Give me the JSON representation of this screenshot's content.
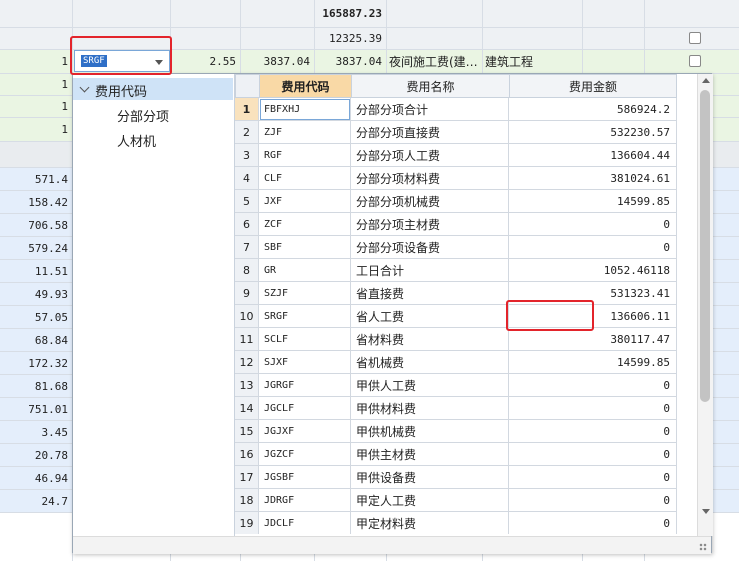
{
  "background": {
    "top_total": "165887.23",
    "subtotal": "12325.39",
    "row_a": {
      "index": "1",
      "code": "SRGF",
      "rate": "2.55",
      "amount1": "3837.04",
      "amount2": "3837.04",
      "name": "夜间施工费(建…",
      "category": "建筑工程"
    },
    "small_rows": [
      "1",
      "1",
      "1"
    ],
    "left_values": [
      "571.4",
      "158.42",
      "706.58",
      "579.24",
      "11.51",
      "49.93",
      "57.05",
      "68.84",
      "172.32",
      "81.68",
      "751.01",
      "3.45",
      "20.78",
      "46.94",
      "24.7"
    ]
  },
  "popup": {
    "tree": {
      "root": "费用代码",
      "children": [
        "分部分项",
        "人材机"
      ]
    },
    "headers": {
      "code": "费用代码",
      "name": "费用名称",
      "amount": "费用金额"
    },
    "rows": [
      {
        "num": "1",
        "code": "FBFXHJ",
        "name": "分部分项合计",
        "amount": "586924.2"
      },
      {
        "num": "2",
        "code": "ZJF",
        "name": "分部分项直接费",
        "amount": "532230.57"
      },
      {
        "num": "3",
        "code": "RGF",
        "name": "分部分项人工费",
        "amount": "136604.44"
      },
      {
        "num": "4",
        "code": "CLF",
        "name": "分部分项材料费",
        "amount": "381024.61"
      },
      {
        "num": "5",
        "code": "JXF",
        "name": "分部分项机械费",
        "amount": "14599.85"
      },
      {
        "num": "6",
        "code": "ZCF",
        "name": "分部分项主材费",
        "amount": "0"
      },
      {
        "num": "7",
        "code": "SBF",
        "name": "分部分项设备费",
        "amount": "0"
      },
      {
        "num": "8",
        "code": "GR",
        "name": "工日合计",
        "amount": "1052.46118"
      },
      {
        "num": "9",
        "code": "SZJF",
        "name": "省直接费",
        "amount": "531323.41"
      },
      {
        "num": "10",
        "code": "SRGF",
        "name": "省人工费",
        "amount": "136606.11"
      },
      {
        "num": "11",
        "code": "SCLF",
        "name": "省材料费",
        "amount": "380117.47"
      },
      {
        "num": "12",
        "code": "SJXF",
        "name": "省机械费",
        "amount": "14599.85"
      },
      {
        "num": "13",
        "code": "JGRGF",
        "name": "甲供人工费",
        "amount": "0"
      },
      {
        "num": "14",
        "code": "JGCLF",
        "name": "甲供材料费",
        "amount": "0"
      },
      {
        "num": "15",
        "code": "JGJXF",
        "name": "甲供机械费",
        "amount": "0"
      },
      {
        "num": "16",
        "code": "JGZCF",
        "name": "甲供主材费",
        "amount": "0"
      },
      {
        "num": "17",
        "code": "JGSBF",
        "name": "甲供设备费",
        "amount": "0"
      },
      {
        "num": "18",
        "code": "JDRGF",
        "name": "甲定人工费",
        "amount": "0"
      },
      {
        "num": "19",
        "code": "JDCLF",
        "name": "甲定材料费",
        "amount": "0"
      }
    ]
  },
  "colors": {
    "accent": "#2f6fc7",
    "highlight": "#e3242b",
    "header_active": "#f9d9a6",
    "tree_selected": "#cfe3f7",
    "row_green": "#eaf5e3",
    "row_blue": "#e4eefb"
  }
}
